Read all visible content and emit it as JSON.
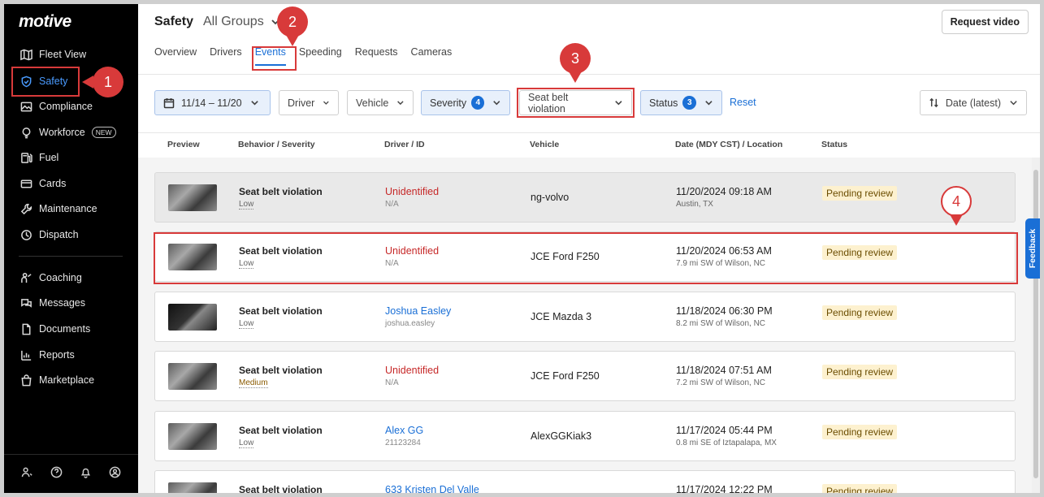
{
  "sidebar": {
    "logo": "motive",
    "items": [
      {
        "label": "Fleet View",
        "icon": "map-icon"
      },
      {
        "label": "Safety",
        "icon": "shield-icon",
        "active": true
      },
      {
        "label": "Compliance",
        "icon": "image-icon"
      },
      {
        "label": "Workforce",
        "icon": "bulb-icon",
        "badge": "NEW"
      },
      {
        "label": "Fuel",
        "icon": "fuel-icon"
      },
      {
        "label": "Cards",
        "icon": "card-icon"
      },
      {
        "label": "Maintenance",
        "icon": "wrench-icon"
      },
      {
        "label": "Dispatch",
        "icon": "dispatch-icon"
      },
      {
        "label": "Coaching",
        "icon": "coaching-icon"
      },
      {
        "label": "Messages",
        "icon": "messages-icon"
      },
      {
        "label": "Documents",
        "icon": "document-icon"
      },
      {
        "label": "Reports",
        "icon": "chart-icon"
      },
      {
        "label": "Marketplace",
        "icon": "bag-icon"
      }
    ]
  },
  "header": {
    "title": "Safety",
    "group": "All Groups",
    "request_video_label": "Request video"
  },
  "tabs": [
    "Overview",
    "Drivers",
    "Events",
    "Speeding",
    "Requests",
    "Cameras"
  ],
  "active_tab": "Events",
  "filters": {
    "date": "11/14 – 11/20",
    "driver": "Driver",
    "vehicle": "Vehicle",
    "severity": "Severity",
    "severity_count": "4",
    "behavior": "Seat belt violation",
    "status": "Status",
    "status_count": "3",
    "reset": "Reset",
    "sort": "Date (latest)"
  },
  "columns": [
    "Preview",
    "Behavior / Severity",
    "Driver / ID",
    "Vehicle",
    "Date (MDY CST) / Location",
    "Status"
  ],
  "rows": [
    {
      "behavior": "Seat belt violation",
      "severity": "Low",
      "driver": "Unidentified",
      "driver_id": "N/A",
      "vehicle": "ng-volvo",
      "date": "11/20/2024 09:18 AM",
      "location": "Austin, TX",
      "status": "Pending review"
    },
    {
      "behavior": "Seat belt violation",
      "severity": "Low",
      "driver": "Unidentified",
      "driver_id": "N/A",
      "vehicle": "JCE Ford F250",
      "date": "11/20/2024 06:53 AM",
      "location": "7.9 mi SW of Wilson, NC",
      "status": "Pending review"
    },
    {
      "behavior": "Seat belt violation",
      "severity": "Low",
      "driver": "Joshua Easley",
      "driver_id": "joshua.easley",
      "vehicle": "JCE Mazda 3",
      "date": "11/18/2024 06:30 PM",
      "location": "8.2 mi SW of Wilson, NC",
      "status": "Pending review"
    },
    {
      "behavior": "Seat belt violation",
      "severity": "Medium",
      "driver": "Unidentified",
      "driver_id": "N/A",
      "vehicle": "JCE Ford F250",
      "date": "11/18/2024 07:51 AM",
      "location": "7.2 mi SW of Wilson, NC",
      "status": "Pending review"
    },
    {
      "behavior": "Seat belt violation",
      "severity": "Low",
      "driver": "Alex GG",
      "driver_id": "21123284",
      "vehicle": "AlexGGKiak3",
      "date": "11/17/2024 05:44 PM",
      "location": "0.8 mi SE of Iztapalapa, MX",
      "status": "Pending review"
    },
    {
      "behavior": "Seat belt violation",
      "severity": "",
      "driver": "633 Kristen Del Valle",
      "driver_id": "",
      "vehicle": "",
      "date": "11/17/2024 12:22 PM",
      "location": "",
      "status": "Pending review"
    }
  ],
  "feedback_label": "Feedback",
  "markers": [
    "1",
    "2",
    "3",
    "4"
  ]
}
